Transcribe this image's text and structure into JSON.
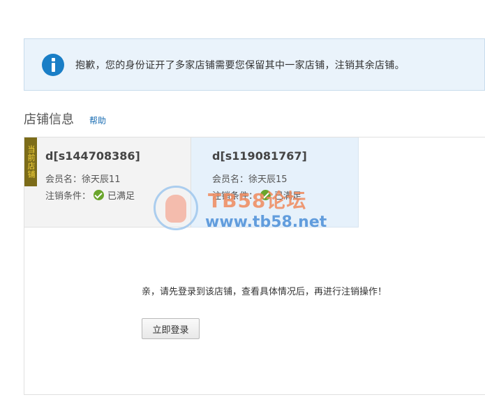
{
  "notice": {
    "icon": "info-icon",
    "text": "抱歉，您的身份证开了多家店铺需要您保留其中一家店铺，注销其余店铺。"
  },
  "section": {
    "title": "店铺信息",
    "help_label": "帮助"
  },
  "stores": [
    {
      "badge": "当前店铺",
      "name": "d[s144708386]",
      "member_label": "会员名：徐天辰11",
      "cond_label": "注销条件：",
      "cond_status": "已满足"
    },
    {
      "name": "d[s119081767]",
      "member_label": "会员名：徐天辰15",
      "cond_label": "注销条件：",
      "cond_status": "已满足"
    }
  ],
  "login": {
    "message": "亲，请先登录到该店铺，查看具体情况后，再进行注销操作！",
    "button_label": "立即登录"
  },
  "watermark": {
    "title": "TB58论坛",
    "url": "www.tb58.net"
  },
  "colors": {
    "notice_bg": "#eaf3fb",
    "info_icon": "#1a7ec6",
    "check": "#6aa52c",
    "badge_bg": "#7c6c19",
    "badge_text": "#f6d53b"
  }
}
